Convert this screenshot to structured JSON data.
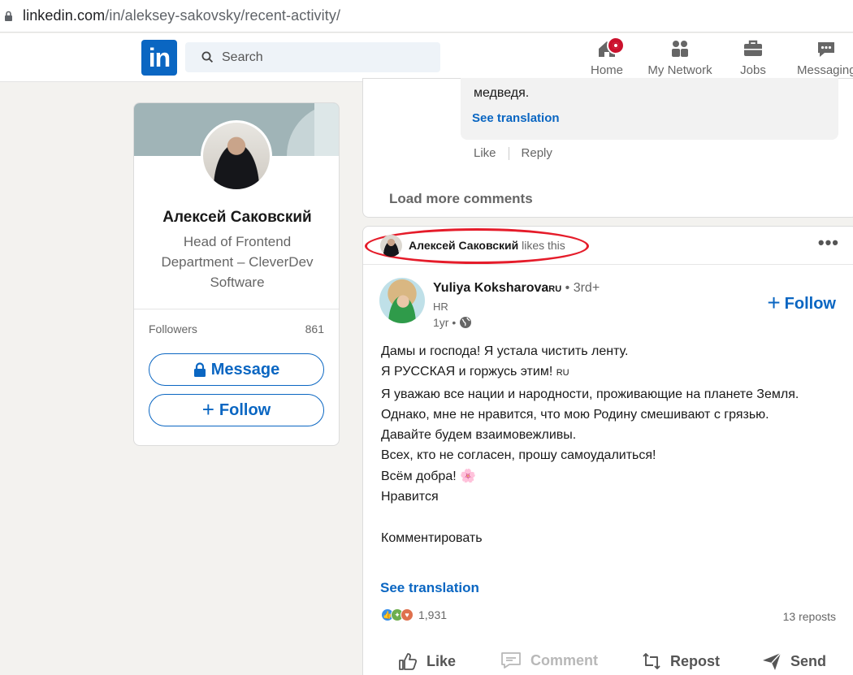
{
  "browser": {
    "url_host": "linkedin.com",
    "url_path": "/in/aleksey-sakovsky/recent-activity/"
  },
  "nav": {
    "logo_text": "in",
    "search_placeholder": "Search",
    "items": [
      {
        "label": "Home",
        "icon": "home-icon"
      },
      {
        "label": "My Network",
        "icon": "network-icon"
      },
      {
        "label": "Jobs",
        "icon": "briefcase-icon"
      },
      {
        "label": "Messaging",
        "icon": "messaging-icon"
      }
    ]
  },
  "profile": {
    "name": "Алексей Саковский",
    "headline": "Head of Frontend Department – CleverDev Software",
    "followers_label": "Followers",
    "followers_count": "861",
    "message_label": "Message",
    "follow_label": "Follow"
  },
  "previous_post": {
    "comment_tail": "медведя.",
    "see_translation": "See translation",
    "like": "Like",
    "reply": "Reply",
    "load_more": "Load more comments"
  },
  "post": {
    "liker_name": "Алексей Саковский",
    "liker_suffix": "likes this",
    "author": {
      "name": "Yuliya Koksharova",
      "name_suffix": "RU",
      "degree": "• 3rd+",
      "headline": "HR",
      "time": "1yr •"
    },
    "follow_label": "Follow",
    "body": {
      "l1": "Дамы и господа! Я устала чистить ленту.",
      "l2": "Я РУССКАЯ и горжусь этим!",
      "l2_suffix": "RU",
      "l3": "Я уважаю все нации и народности, проживающие на планете Земля.",
      "l4": "Однако, мне не нравится, что мою Родину смешивают с грязью.",
      "l5": "Давайте будем взаимовежливы.",
      "l6": "Всех, кто не согласен, прошу самоудалиться!",
      "l7": "Всём добра!",
      "l7_emoji": "🌸",
      "l8": "Нравится",
      "l9": "",
      "l10": "Комментировать"
    },
    "see_translation": "See translation",
    "reactions_count": "1,931",
    "reposts": "13 reposts",
    "actions": {
      "like": "Like",
      "comment": "Comment",
      "repost": "Repost",
      "send": "Send"
    }
  },
  "colors": {
    "brand": "#0a66c2",
    "highlight_ring": "#e51c2a",
    "page_bg": "#f3f2ef"
  }
}
